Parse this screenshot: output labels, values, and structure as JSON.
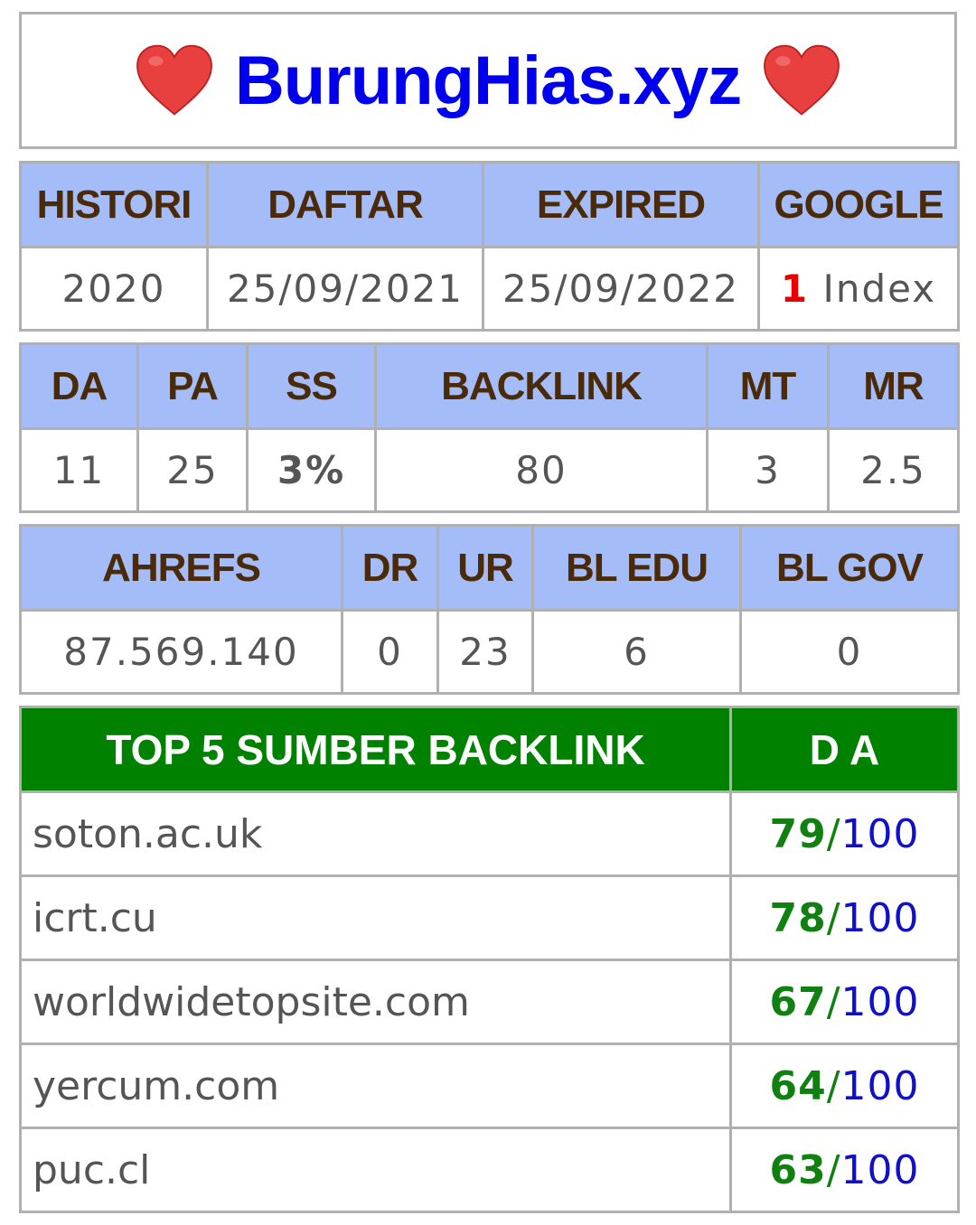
{
  "title": {
    "site_name": "BurungHias.xyz",
    "left_icon": "heart-icon",
    "right_icon": "heart-icon",
    "heart_color": "#e8403f",
    "title_color": "#0000ee"
  },
  "domain_info": {
    "headers": [
      "HISTORI",
      "DAFTAR",
      "EXPIRED",
      "GOOGLE"
    ],
    "histori": "2020",
    "daftar": "25/09/2021",
    "expired": "25/09/2022",
    "google_count": "1",
    "google_label": "Index"
  },
  "moz": {
    "headers": [
      "DA",
      "PA",
      "SS",
      "BACKLINK",
      "MT",
      "MR"
    ],
    "da": "11",
    "pa": "25",
    "ss": "3%",
    "backlink": "80",
    "mt": "3",
    "mr": "2.5"
  },
  "ahrefs": {
    "headers": [
      "AHREFS",
      "DR",
      "UR",
      "BL EDU",
      "BL GOV"
    ],
    "rank": "87.569.140",
    "dr": "0",
    "ur": "23",
    "bl_edu": "6",
    "bl_gov": "0"
  },
  "top_sources": {
    "header_source": "TOP 5 SUMBER BACKLINK",
    "header_da": "D A",
    "max": "100",
    "rows": [
      {
        "domain": "soton.ac.uk",
        "da": "79"
      },
      {
        "domain": "icrt.cu",
        "da": "78"
      },
      {
        "domain": "worldwidetopsite.com",
        "da": "67"
      },
      {
        "domain": "yercum.com",
        "da": "64"
      },
      {
        "domain": "puc.cl",
        "da": "63"
      }
    ]
  },
  "colors": {
    "header_bg": "#a4bcf7",
    "header_text": "#4a2a08",
    "top_header_bg": "#008200",
    "green": "#108010",
    "blue": "#1010c8",
    "red": "#e60000"
  }
}
